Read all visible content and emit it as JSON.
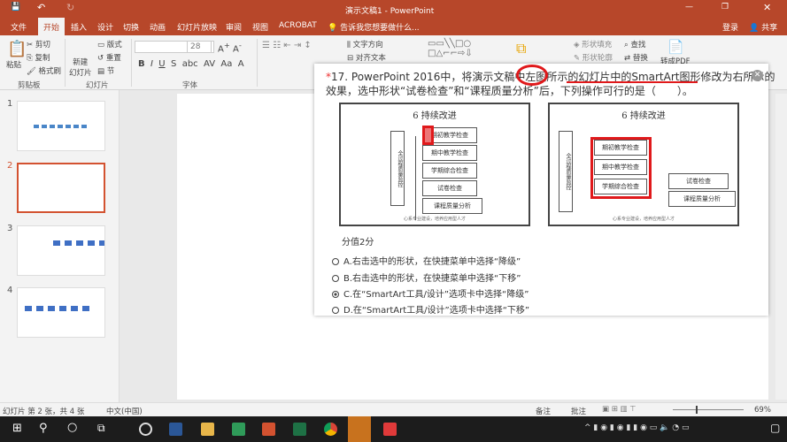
{
  "title": "演示文稿1 - PowerPoint",
  "tabs": [
    "文件",
    "开始",
    "插入",
    "设计",
    "切换",
    "动画",
    "幻灯片放映",
    "审阅",
    "视图",
    "ACROBAT"
  ],
  "tell_me": "告诉我您想要做什么...",
  "login": "登录",
  "share": "共享",
  "ribbon": {
    "paste": "粘贴",
    "cut": "剪切",
    "copy": "复制",
    "format_painter": "格式刷",
    "new_slide": "新建\n幻灯片",
    "layout": "版式",
    "reset": "重置",
    "section": "节",
    "font_size": "28",
    "text_direction": "文字方向",
    "align_text": "对齐文本",
    "shape_fill": "形状填充",
    "shape_outline": "形状轮廓",
    "find": "查找",
    "replace": "替换",
    "groups": [
      "剪贴板",
      "幻灯片",
      "字体"
    ],
    "pdf": "转成PDF"
  },
  "slides": [
    "1",
    "2",
    "3",
    "4"
  ],
  "question": {
    "line1": "17. PowerPoint 2016中，将演示文稿中左图所示的幻灯片中的SmartArt图形修改为右所示的",
    "line2": "效果，选中形状“试卷检查”和“课程质量分析”后，下列操作可行的是（　　）。",
    "score": "分值2分",
    "options": [
      "A.右击选中的形状，在快捷菜单中选择“降级”",
      "B.右击选中的形状，在快捷菜单中选择“下移”",
      "C.在“SmartArt工具/设计”选项卡中选择“降级”",
      "D.在“SmartArt工具/设计”选项卡中选择“下移”"
    ],
    "selected": 2,
    "fig_title": "6 持续改进",
    "fig_side": "全过程质量监控",
    "fig_items": [
      "期初教学检查",
      "期中教学检查",
      "学期综合检查",
      "试卷检查",
      "课程质量分析"
    ],
    "fig_footer": "心系专业建设，培养应用型人才",
    "highlight_color": "#e0191b"
  },
  "status": {
    "slide_info": "幻灯片 第 2 张，共 4 张",
    "language": "中文(中国)",
    "notes": "备注",
    "comments": "批注",
    "zoom": "69%"
  },
  "accent": "#b7472a"
}
